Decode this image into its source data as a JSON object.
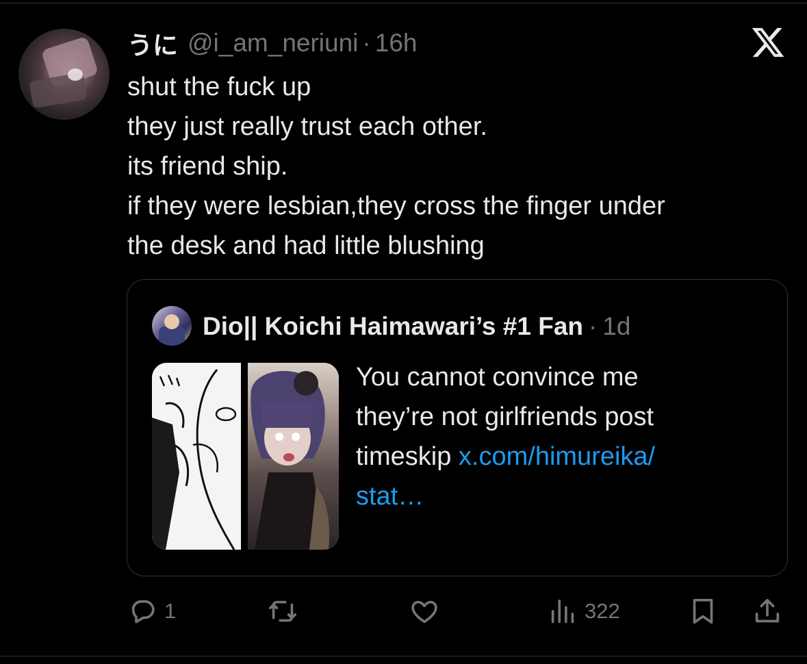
{
  "tweet": {
    "display_name": "うに",
    "handle": "@i_am_neriuni",
    "separator": "·",
    "time": "16h",
    "lines": [
      "shut the fuck up",
      "they just really trust each other.",
      "its friend ship.",
      "if they were lesbian,they cross the finger under",
      "the desk and had little blushing"
    ]
  },
  "quote": {
    "display_name": "Dio|| Koichi Haimawari’s #1 Fan",
    "separator": "·",
    "time": "1d",
    "text_lines": [
      "You cannot convince me",
      "they’re not girlfriends post"
    ],
    "text_line3_prefix": "timeskip ",
    "link_part1": "x.com/himureika/",
    "link_part2": "stat…"
  },
  "actions": {
    "reply_count": "1",
    "views_count": "322"
  },
  "icons": {
    "logo": "x-logo-icon",
    "reply": "reply-icon",
    "repost": "repost-icon",
    "like": "heart-icon",
    "views": "views-icon",
    "bookmark": "bookmark-icon",
    "share": "share-icon"
  },
  "colors": {
    "background": "#000000",
    "text": "#e7e9ea",
    "muted": "#71767b",
    "link": "#1d9bf0",
    "border": "#2f3336"
  }
}
